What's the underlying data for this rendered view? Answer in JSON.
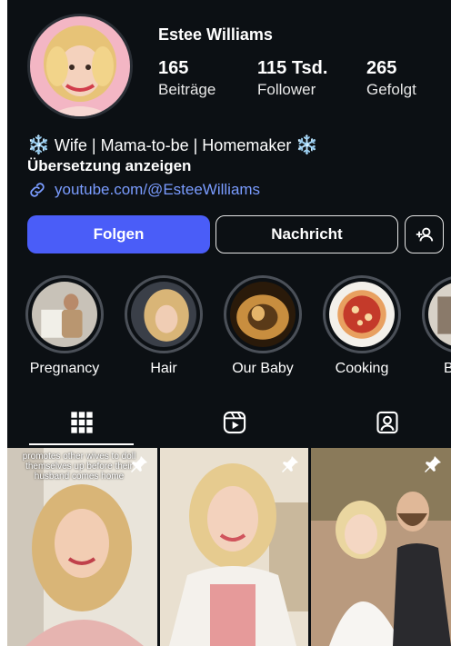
{
  "profile": {
    "name": "Estee Williams",
    "stats": [
      {
        "value": "165",
        "label": "Beiträge"
      },
      {
        "value": "115 Tsd.",
        "label": "Follower"
      },
      {
        "value": "265",
        "label": "Gefolgt"
      }
    ],
    "bio": {
      "snowflake": "❄️",
      "text": "Wife | Mama-to-be | Homemaker"
    },
    "translate": "Übersetzung anzeigen",
    "link": "youtube.com/@EsteeWilliams"
  },
  "actions": {
    "follow": "Folgen",
    "message": "Nachricht"
  },
  "highlights": [
    {
      "label": "Pregnancy"
    },
    {
      "label": "Hair"
    },
    {
      "label": "Our Baby"
    },
    {
      "label": "Cooking"
    },
    {
      "label": "Be"
    }
  ],
  "tabs": [
    "posts-grid-icon",
    "reels-icon",
    "tagged-icon"
  ],
  "posts": [
    {
      "caption": "promotes other wives to doll themselves up before their husband comes home",
      "pinned": true
    },
    {
      "caption": "",
      "pinned": true
    },
    {
      "caption": "",
      "pinned": true
    }
  ],
  "colors": {
    "background": "#0c1014",
    "accent": "#4a5df8",
    "link": "#7a9cff"
  }
}
